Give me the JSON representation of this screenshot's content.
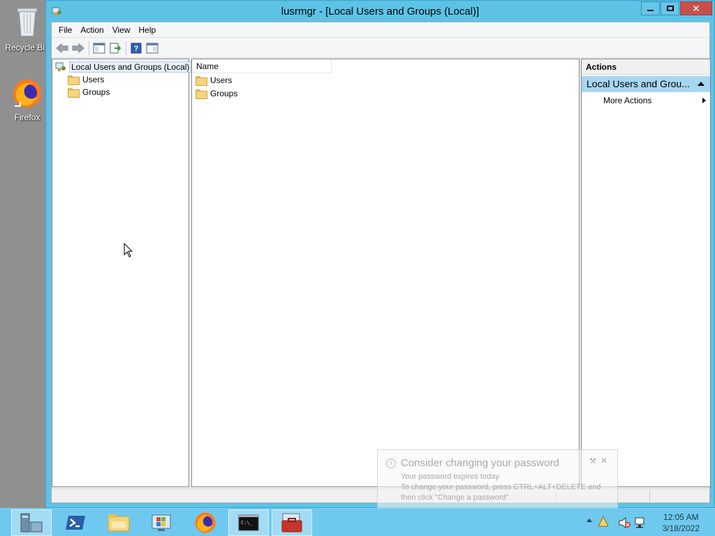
{
  "desktop": {
    "icons": [
      {
        "label": "Recycle Bin"
      },
      {
        "label": "Firefox"
      }
    ]
  },
  "window": {
    "title": "lusrmgr - [Local Users and Groups (Local)]",
    "caption_buttons": {
      "minimize": "—",
      "maximize": "☐",
      "close": "✕"
    }
  },
  "menubar": {
    "items": [
      "File",
      "Action",
      "View",
      "Help"
    ]
  },
  "toolbar": {
    "buttons": [
      "back-icon",
      "forward-icon",
      "show-hide-console-tree-icon",
      "export-list-icon",
      "help-icon",
      "show-hide-action-pane-icon"
    ]
  },
  "tree": {
    "root": "Local Users and Groups (Local)",
    "children": [
      "Users",
      "Groups"
    ]
  },
  "list": {
    "column_name": "Name",
    "items": [
      "Users",
      "Groups"
    ]
  },
  "actions": {
    "title": "Actions",
    "group": "Local Users and Grou...",
    "more": "More Actions"
  },
  "notification": {
    "title": "Consider changing your password",
    "line1": "Your password expires today.",
    "line2": "To change your password, press CTRL+ALT+DELETE and",
    "line3": "then click \"Change a password\"."
  },
  "taskbar": {
    "apps": [
      "server-manager-icon",
      "powershell-icon",
      "file-explorer-icon",
      "windows-update-icon",
      "firefox-icon",
      "command-prompt-icon",
      "computer-management-icon"
    ],
    "clock": {
      "time": "12:05 AM",
      "date": "3/18/2022"
    }
  },
  "colors": {
    "window_frame": "#5cc3e7",
    "taskbar": "#6fc9ef",
    "close_button": "#c7504b",
    "selected_group": "#a7d6f1"
  }
}
